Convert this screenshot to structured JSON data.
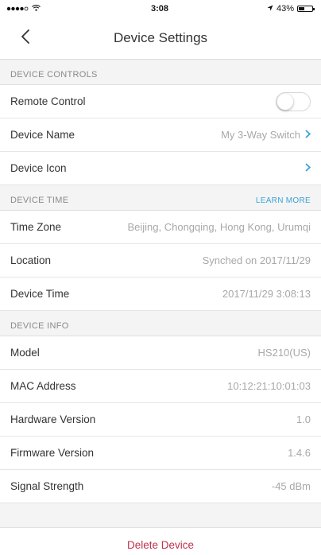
{
  "status_bar": {
    "time": "3:08",
    "battery": "43%",
    "battery_level": 0.43
  },
  "nav": {
    "title": "Device Settings"
  },
  "device_controls": {
    "header": "DEVICE CONTROLS",
    "remote_control_label": "Remote Control",
    "remote_control_on": false,
    "device_name_label": "Device Name",
    "device_name_value": "My 3-Way Switch",
    "device_icon_label": "Device Icon"
  },
  "device_time": {
    "header": "DEVICE TIME",
    "learn_more": "LEARN MORE",
    "time_zone_label": "Time Zone",
    "time_zone_value": "Beijing, Chongqing, Hong Kong, Urumqi",
    "location_label": "Location",
    "location_value": "Synched on 2017/11/29",
    "device_time_label": "Device Time",
    "device_time_value": "2017/11/29 3:08:13"
  },
  "device_info": {
    "header": "DEVICE INFO",
    "model_label": "Model",
    "model_value": "HS210(US)",
    "mac_label": "MAC Address",
    "mac_value": "10:12:21:10:01:03",
    "hw_label": "Hardware Version",
    "hw_value": "1.0",
    "fw_label": "Firmware Version",
    "fw_value": "1.4.6",
    "signal_label": "Signal Strength",
    "signal_value": "-45 dBm"
  },
  "actions": {
    "delete_label": "Delete Device"
  },
  "colors": {
    "accent": "#3aa3d8",
    "destructive": "#c0304a"
  },
  "icons": {
    "back": "chevron-left-icon",
    "chevron": "chevron-right-icon",
    "signal": "signal-dots-icon",
    "wifi": "wifi-icon",
    "location": "location-arrow-icon",
    "battery": "battery-icon"
  }
}
